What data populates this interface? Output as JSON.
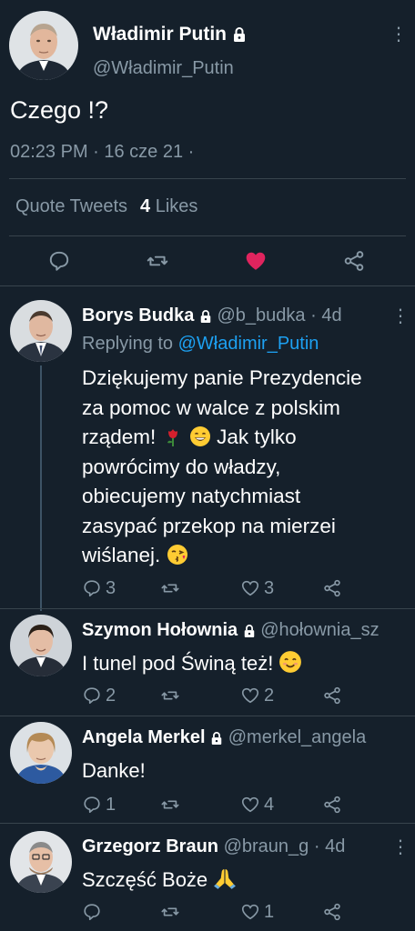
{
  "main_tweet": {
    "author_name": "Władimir Putin",
    "handle": "@Władimir_Putin",
    "text": "Czego !?",
    "timestamp": "02:23 PM · 16 cze 21 ·",
    "stats": {
      "quote_tweets_label": "Quote Tweets",
      "likes_count": "4",
      "likes_label": "Likes"
    },
    "liked": true
  },
  "replies": [
    {
      "author_name": "Borys Budka",
      "handle": "@b_budka",
      "time": "· 4d",
      "replying_to_label": "Replying to",
      "replying_to_handle": "@Władimir_Putin",
      "lines": [
        "Dziękujemy panie Prezydencie",
        "za pomoc w walce z polskim",
        "rządem!",
        "Jak tylko",
        "powrócimy do władzy,",
        "obiecujemy natychmiast",
        "zasypać przekop na mierzei",
        "wiślanej."
      ],
      "reply_count": "3",
      "retweet_count": "",
      "like_count": "3"
    },
    {
      "author_name": "Szymon Hołownia",
      "handle": "@hołownia_sz",
      "time": "",
      "text": "I tunel pod Świną też!",
      "reply_count": "2",
      "retweet_count": "",
      "like_count": "2"
    },
    {
      "author_name": "Angela Merkel",
      "handle": "@merkel_angela",
      "time": "",
      "text": "Danke!",
      "reply_count": "1",
      "retweet_count": "",
      "like_count": "4"
    },
    {
      "author_name": "Grzegorz Braun",
      "handle": "@braun_g",
      "time": "· 4d",
      "text": "Szczęść Boże",
      "reply_count": "",
      "retweet_count": "",
      "like_count": "1"
    }
  ],
  "colors": {
    "background": "#15202b",
    "muted": "#8899a6",
    "link": "#1da1f2",
    "like": "#e0245e",
    "divider": "#38444d"
  },
  "icons": [
    "lock-icon",
    "more-icon",
    "reply-icon",
    "retweet-icon",
    "heart-icon",
    "share-icon",
    "rose-emoji",
    "grin-emoji",
    "kiss-emoji",
    "smile-emoji",
    "pray-emoji"
  ]
}
